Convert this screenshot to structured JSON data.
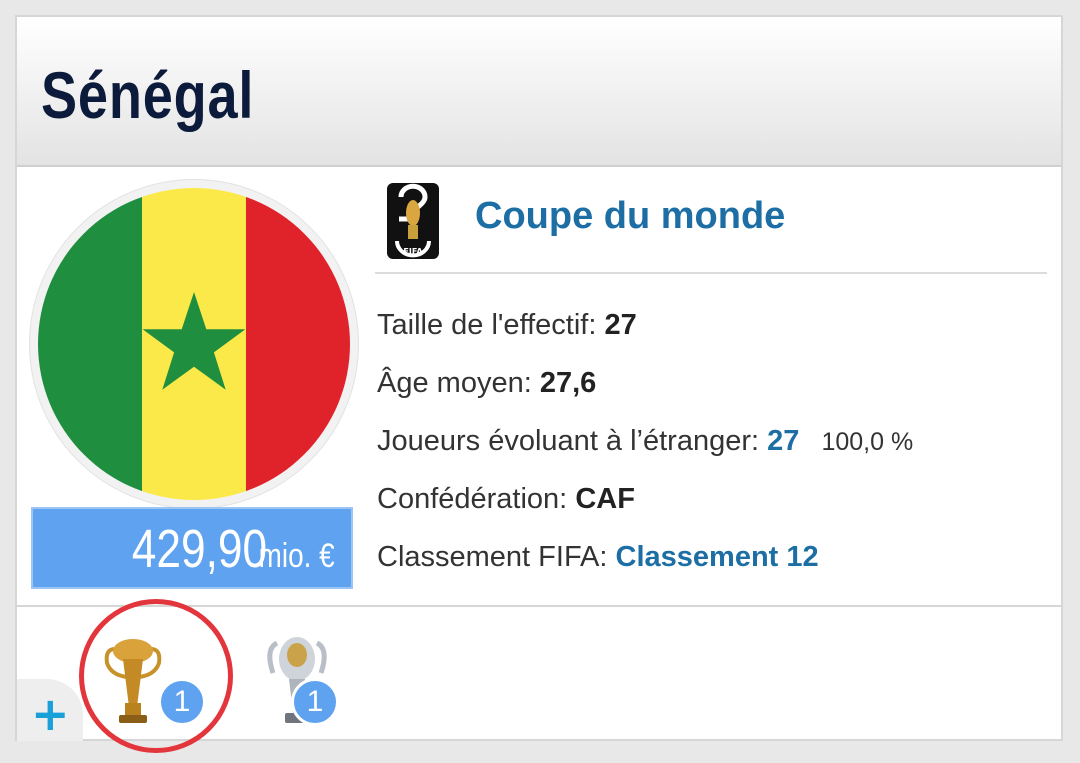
{
  "team": {
    "name": "Sénégal",
    "market_value": "429,90",
    "market_value_unit": "mio. €",
    "flag_icon": "senegal-flag-icon"
  },
  "competition": {
    "title": "Coupe du monde",
    "logo_icon": "world-cup-2026-logo-icon",
    "logo_caption": "FIFA"
  },
  "stats": {
    "squad_size_label": "Taille de l'effectif:",
    "squad_size_value": "27",
    "avg_age_label": "Âge moyen:",
    "avg_age_value": "27,6",
    "foreign_label": "Joueurs évoluant à l’étranger:",
    "foreign_value": "27",
    "foreign_pct": "100,0 %",
    "confederation_label": "Confédération:",
    "confederation_value": "CAF",
    "fifa_rank_label": "Classement FIFA:",
    "fifa_rank_value": "Classement 12"
  },
  "trophies": [
    {
      "icon": "africa-cup-trophy-icon",
      "count": "1"
    },
    {
      "icon": "silver-trophy-icon",
      "count": "1"
    }
  ],
  "expand_label": "+",
  "colors": {
    "accent_blue": "#1c6ea4",
    "badge_blue": "#5ea2f0",
    "highlight_red": "#e2353c",
    "flag_green": "#1f8e3f",
    "flag_yellow": "#fbe94a",
    "flag_red": "#e0222a"
  }
}
